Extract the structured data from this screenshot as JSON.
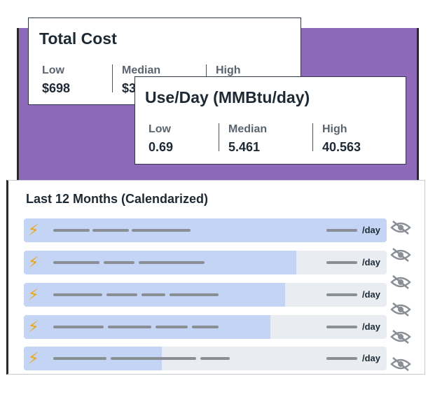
{
  "total_cost": {
    "title": "Total Cost",
    "low_label": "Low",
    "low_value": "$698",
    "median_label": "Median",
    "median_value": "$3",
    "high_label": "High"
  },
  "use_per_day": {
    "title": "Use/Day (MMBtu/day)",
    "low_label": "Low",
    "low_value": "0.69",
    "median_label": "Median",
    "median_value": "5.461",
    "high_label": "High",
    "high_value": "40.563"
  },
  "months": {
    "title": "Last 12 Months (Calendarized)",
    "rows": [
      {
        "unit": "/day",
        "fill_percent": 100
      },
      {
        "unit": "/day",
        "fill_percent": 75
      },
      {
        "unit": "/day",
        "fill_percent": 72
      },
      {
        "unit": "/day",
        "fill_percent": 68
      },
      {
        "unit": "/day",
        "fill_percent": 38
      }
    ]
  },
  "icons": {
    "row_icon": "lightning-bolt-icon",
    "hide_icon": "eye-off-icon"
  },
  "colors": {
    "accent_purple": "#8e69b9",
    "bar_fill": "#c4d4f4",
    "bar_track": "#e9edf1",
    "bolt": "#f0a500"
  }
}
